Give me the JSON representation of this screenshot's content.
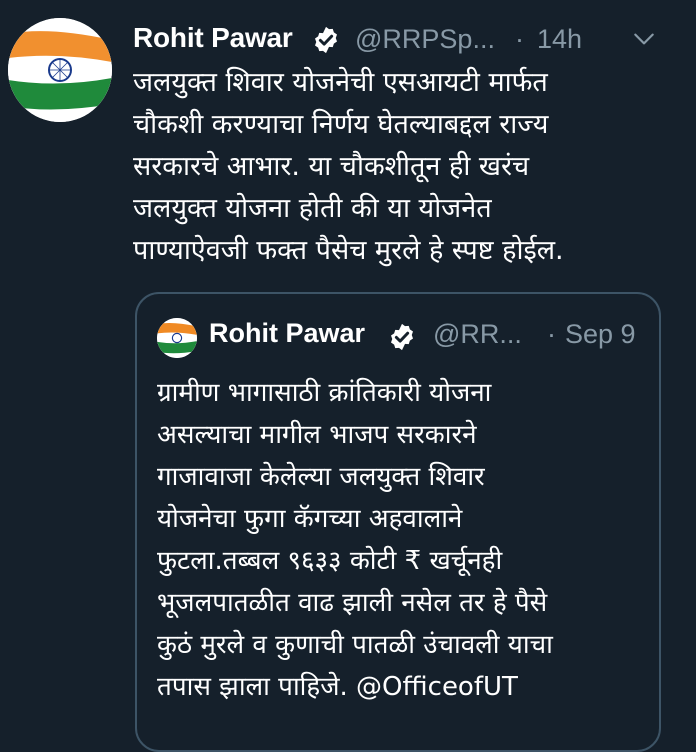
{
  "tweet": {
    "author_name": "Rohit Pawar",
    "handle": "@RRPSp...",
    "separator": "·",
    "time": "14h",
    "text": "जलयुक्त शिवार योजनेची एसआयटी मार्फत\nचौकशी करण्याचा निर्णय घेतल्याबद्दल राज्य\nसरकारचे आभार. या चौकशीतून ही खरंच\nजलयुक्त योजना होती की या योजनेत\nपाण्याऐवजी फक्त पैसेच मुरले हे स्पष्ट होईल."
  },
  "quoted": {
    "author_name": "Rohit Pawar",
    "handle": "@RR...",
    "separator": "·",
    "time": "Sep 9",
    "text": "ग्रामीण भागासाठी क्रांतिकारी योजना\nअसल्याचा मागील भाजप सरकारने\nगाजावाजा केलेल्या जलयुक्त शिवार\nयोजनेचा फुगा कॅगच्या अहवालाने\nफुटला.तब्बल ९६३३ कोटी ₹ खर्चूनही\nभूजलपातळीत वाढ झाली नसेल तर हे पैसे\nकुठं मुरले व कुणाची पातळी उंचावली याचा\nतपास झाला पाहिजे. @OfficeofUT"
  },
  "icons": {
    "avatar": "india-flag-avatar-icon",
    "verified": "verified-badge-icon",
    "menu": "chevron-down-icon"
  },
  "colors": {
    "background": "#15202b",
    "secondary_text": "#8899a6",
    "quote_border": "#3d5466",
    "saffron": "#f08a24",
    "green": "#1f8a3b",
    "chakra": "#1a3a8c"
  }
}
